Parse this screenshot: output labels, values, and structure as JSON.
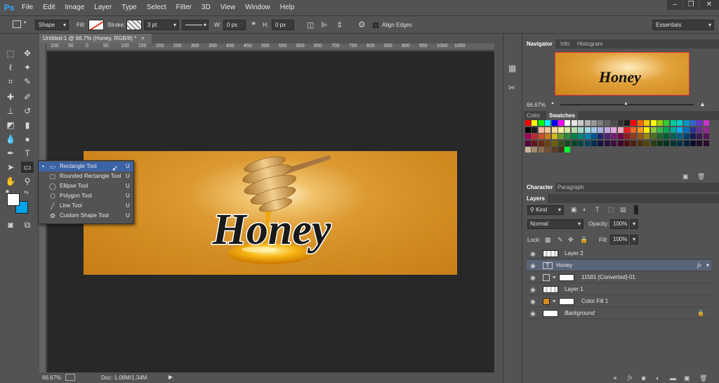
{
  "app": {
    "logo": "Ps"
  },
  "menu": [
    "File",
    "Edit",
    "Image",
    "Layer",
    "Type",
    "Select",
    "Filter",
    "3D",
    "View",
    "Window",
    "Help"
  ],
  "window_controls": {
    "minimize": "–",
    "restore": "❐",
    "close": "✕"
  },
  "options": {
    "mode": "Shape",
    "fill_label": "Fill:",
    "stroke_label": "Stroke:",
    "stroke_width": "3 pt",
    "w_label": "W:",
    "w_value": "0 px",
    "link_icon": "link-icon",
    "h_label": "H:",
    "h_value": "0 px",
    "align_edges": "Align Edges",
    "workspace": "Essentials"
  },
  "document": {
    "tab_title": "Untitled-1 @ 66.7% (Honey, RGB/8) *",
    "close": "×",
    "ruler_ticks": [
      "100",
      "50",
      "0",
      "50",
      "100",
      "150",
      "200",
      "250",
      "300",
      "350",
      "400",
      "450",
      "500",
      "550",
      "600",
      "650",
      "700",
      "750",
      "800",
      "850",
      "900",
      "950",
      "1000",
      "1050"
    ],
    "zoom": "66.67%",
    "doc_size": "Doc: 1.08M/1.34M"
  },
  "artwork": {
    "text": "Honey"
  },
  "shape_flyout": [
    {
      "name": "Rectangle Tool",
      "key": "U",
      "icon": "rectangle-icon"
    },
    {
      "name": "Rounded Rectangle Tool",
      "key": "U",
      "icon": "rounded-rectangle-icon"
    },
    {
      "name": "Ellipse Tool",
      "key": "U",
      "icon": "ellipse-icon"
    },
    {
      "name": "Polygon Tool",
      "key": "U",
      "icon": "polygon-icon"
    },
    {
      "name": "Line Tool",
      "key": "U",
      "icon": "line-icon"
    },
    {
      "name": "Custom Shape Tool",
      "key": "U",
      "icon": "custom-shape-icon"
    }
  ],
  "colors": {
    "foreground": "#ffffff",
    "background": "#00a2e8",
    "accent": "#31a8ff",
    "honey": "#d18c22"
  },
  "navigator": {
    "tabs": [
      "Navigator",
      "Info",
      "Histogram"
    ],
    "zoom": "66.67%"
  },
  "swatches": {
    "tabs": [
      "Color",
      "Swatches"
    ],
    "colors": [
      "#ff0000",
      "#ffff00",
      "#00ff00",
      "#00ffff",
      "#0000ff",
      "#ff00ff",
      "#ffffff",
      "#e6e6e6",
      "#cccccc",
      "#b3b3b3",
      "#999999",
      "#808080",
      "#666666",
      "#4d4d4d",
      "#333333",
      "#1a1a1a",
      "#ff0000",
      "#ff6600",
      "#ffcc00",
      "#ffff00",
      "#99cc00",
      "#33cc33",
      "#00cc99",
      "#00cccc",
      "#0099cc",
      "#3366cc",
      "#6633cc",
      "#cc33cc",
      "#000000",
      "#1a1a1a",
      "#f2b6a0",
      "#f5c49a",
      "#f7da9a",
      "#f8f0a0",
      "#d4e6a0",
      "#b8dca8",
      "#a8d8c8",
      "#a0d8e0",
      "#a0c8e8",
      "#a8b0e0",
      "#c0a8e0",
      "#e0a8e0",
      "#e8a8c0",
      "#ed1c24",
      "#f26522",
      "#f7941d",
      "#fff200",
      "#8dc63f",
      "#39b54a",
      "#00a651",
      "#00a99d",
      "#00aeef",
      "#0072bc",
      "#2e3192",
      "#662d91",
      "#92278f",
      "#9e005d",
      "#c1272d",
      "#c6502a",
      "#c97c1f",
      "#cfb71c",
      "#6b9a34",
      "#2c8a3d",
      "#00804a",
      "#008479",
      "#0081b5",
      "#005590",
      "#1f2370",
      "#4f2170",
      "#711d70",
      "#760048",
      "#8c1d22",
      "#8f3a1e",
      "#925a16",
      "#968614",
      "#4e7025",
      "#20652c",
      "#005e36",
      "#005f58",
      "#005e84",
      "#003f6b",
      "#161a52",
      "#3a1852",
      "#521553",
      "#570034",
      "#661418",
      "#692a16",
      "#6b4210",
      "#6e610f",
      "#39521b",
      "#174a20",
      "#004527",
      "#004641",
      "#004560",
      "#002e4e",
      "#10133c",
      "#2b123c",
      "#3c0f3d",
      "#3f0026",
      "#4b0f12",
      "#4d1f10",
      "#4e300c",
      "#50470b",
      "#2a3c14",
      "#113617",
      "#00321d",
      "#003330",
      "#003246",
      "#002239",
      "#0c0e2c",
      "#1f0d2c",
      "#2c0b2d",
      "#c8b49a",
      "#a38c6e",
      "#8c6e4c",
      "#735032",
      "#5c3d26",
      "#46301e",
      "#00ff33"
    ]
  },
  "character": {
    "tabs": [
      "Character",
      "Paragraph"
    ]
  },
  "layers": {
    "tab": "Layers",
    "kind": "Kind",
    "blend": "Normal",
    "opacity_label": "Opacity:",
    "opacity": "100%",
    "lock_label": "Lock:",
    "fill_label": "Fill:",
    "fill": "100%",
    "fx": "fx",
    "items": [
      {
        "name": "Layer 2",
        "type": "transparent"
      },
      {
        "name": "Honey",
        "type": "text",
        "selected": true
      },
      {
        "name": "11581 [Converted]-01",
        "type": "smart"
      },
      {
        "name": "Layer 1",
        "type": "transparent"
      },
      {
        "name": "Color Fill 1",
        "type": "fill"
      },
      {
        "name": "Background",
        "type": "background"
      }
    ]
  }
}
